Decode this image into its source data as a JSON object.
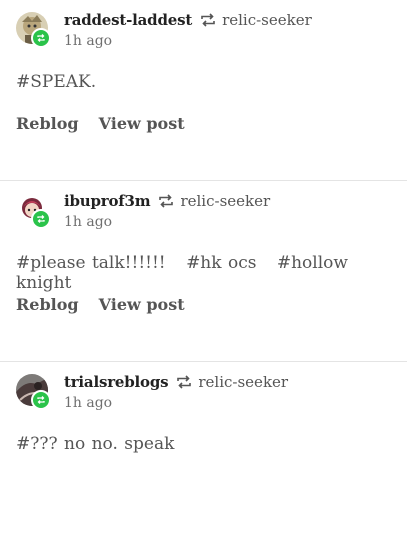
{
  "posts": [
    {
      "username": "raddest-laddest",
      "source": "relic-seeker",
      "time": "1h ago",
      "tags": [
        "#SPEAK."
      ],
      "avatar_color": "#b9a67c"
    },
    {
      "username": "ibuprof3m",
      "source": "relic-seeker",
      "time": "1h ago",
      "tags": [
        "#please talk!!!!!!",
        "#hk ocs",
        "#hollow knight"
      ],
      "avatar_color": "#c0405a"
    },
    {
      "username": "trialsreblogs",
      "source": "relic-seeker",
      "time": "1h ago",
      "tags": [
        "#??? no no. speak"
      ],
      "avatar_color": "#4a3b3b"
    }
  ],
  "actions": {
    "reblog_label": "Reblog",
    "view_post_label": "View post"
  },
  "icons": {
    "reblog": "reblog-icon",
    "badge": "reblog-badge-icon"
  },
  "colors": {
    "badge_green": "#2bc34a",
    "divider": "#e4e4e4"
  }
}
